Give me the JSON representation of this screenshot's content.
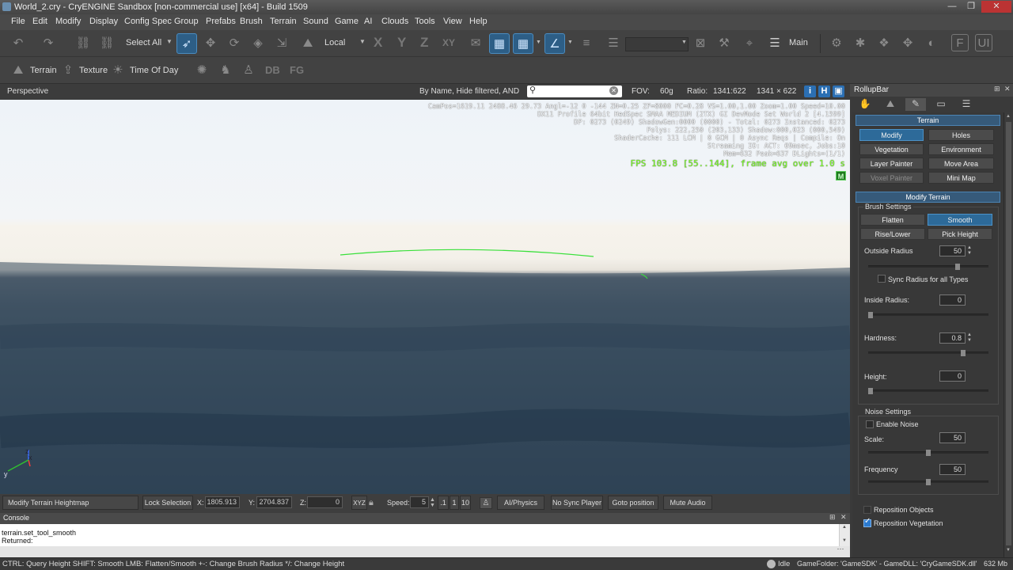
{
  "window": {
    "title": "World_2.cry - CryENGINE Sandbox [non-commercial use] [x64] - Build 1509"
  },
  "menu": [
    "File",
    "Edit",
    "Modify",
    "Display",
    "Config Spec",
    "Group",
    "Prefabs",
    "Brush",
    "Terrain",
    "Sound",
    "Game",
    "AI",
    "Clouds",
    "Tools",
    "View",
    "Help"
  ],
  "toolbar": {
    "select_all": "Select All",
    "coord_space": "Local",
    "layer_main": "Main",
    "axis_labels": [
      "X",
      "Y",
      "Z",
      "XY"
    ]
  },
  "toolbar2": {
    "terrain": "Terrain",
    "texture": "Texture",
    "time_of_day": "Time Of Day",
    "db": "DB",
    "fg": "FG"
  },
  "viewport_header": {
    "name": "Perspective",
    "filter": "By Name, Hide filtered, AND",
    "fov_label": "FOV:",
    "fov_value": "60g",
    "ratio_label": "Ratio:",
    "ratio_value": "1341:622",
    "size_value": "1341 × 622"
  },
  "hud": {
    "lines": [
      "CamPos=1619.11 2488.46 29.73 Angl=-12  0 -144 ZN=0.25 ZF=8000 FC=0.28 VS=1.00,1.00 Zoom=1.00 Speed=10.00",
      "DX11 Profile 64bit HedSpec SMAA MEDIUM (2TX) GI DevMode Set World 2 [4.1599]",
      "DP: 0273 (0249) ShadowGen:0000 (0000) - Total: 0273 Instanced: 0273",
      "Polys: 222,250 (203,133) Shadow:000,023 (000,549)",
      "ShaderCache: 111 LCM | 0 GCM | 0 Async Reqs | Compile: On",
      "Streaming IO: ACT:  69msec, Jobs:10",
      "Mem=632 Peak=637 DLights=(1/1)"
    ],
    "fps": "FPS 103.8 [55..144], frame avg over 1.0 s",
    "badge": "M",
    "axes": {
      "z": "z",
      "x": "x",
      "y": "y"
    }
  },
  "bottombar": {
    "heightmap": "Modify Terrain Heightmap",
    "lock": "Lock Selection",
    "x_label": "X:",
    "x_value": "1805.913",
    "y_label": "Y:",
    "y_value": "2704.837",
    "z_label": "Z:",
    "z_value": "0",
    "xyz": "XYZ",
    "speed_label": "Speed:",
    "speed_value": "5",
    "speed_opts": [
      ".1",
      "1",
      "10"
    ],
    "ai_physics": "AI/Physics",
    "no_sync": "No Sync Player",
    "goto": "Goto position",
    "mute": "Mute Audio"
  },
  "console": {
    "title": "Console",
    "lines": [
      "terrain.set_tool_smooth",
      "Returned:"
    ]
  },
  "status": {
    "hint": "CTRL: Query Height  SHIFT: Smooth  LMB: Flatten/Smooth  +-: Change Brush Radius  */: Change Height",
    "state": "Idle",
    "game_folder": "GameFolder: 'GameSDK' - GameDLL: 'CryGameSDK.dll'",
    "memory": "632 Mb"
  },
  "rollup": {
    "title": "RollupBar",
    "terrain_section": "Terrain",
    "buttons": [
      "Modify",
      "Holes",
      "Vegetation",
      "Environment",
      "Layer Painter",
      "Move Area",
      "Voxel Painter",
      "Mini Map"
    ],
    "modify_section": "Modify Terrain",
    "brush_settings": "Brush Settings",
    "brush_types": [
      "Flatten",
      "Smooth",
      "Rise/Lower",
      "Pick Height"
    ],
    "outside_radius_label": "Outside Radius",
    "outside_radius": "50",
    "sync_radius": "Sync Radius for all Types",
    "inside_radius_label": "Inside Radius:",
    "inside_radius": "0",
    "hardness_label": "Hardness:",
    "hardness": "0.8",
    "height_label": "Height:",
    "height": "0",
    "noise_settings": "Noise Settings",
    "enable_noise": "Enable Noise",
    "scale_label": "Scale:",
    "scale": "50",
    "frequency_label": "Frequency",
    "frequency": "50",
    "reposition_objects": "Reposition Objects",
    "reposition_vegetation": "Reposition Vegetation"
  },
  "colors": {
    "accent": "#2d6a99",
    "fps": "#7dff2a",
    "brush_circle": "#39e03a"
  }
}
